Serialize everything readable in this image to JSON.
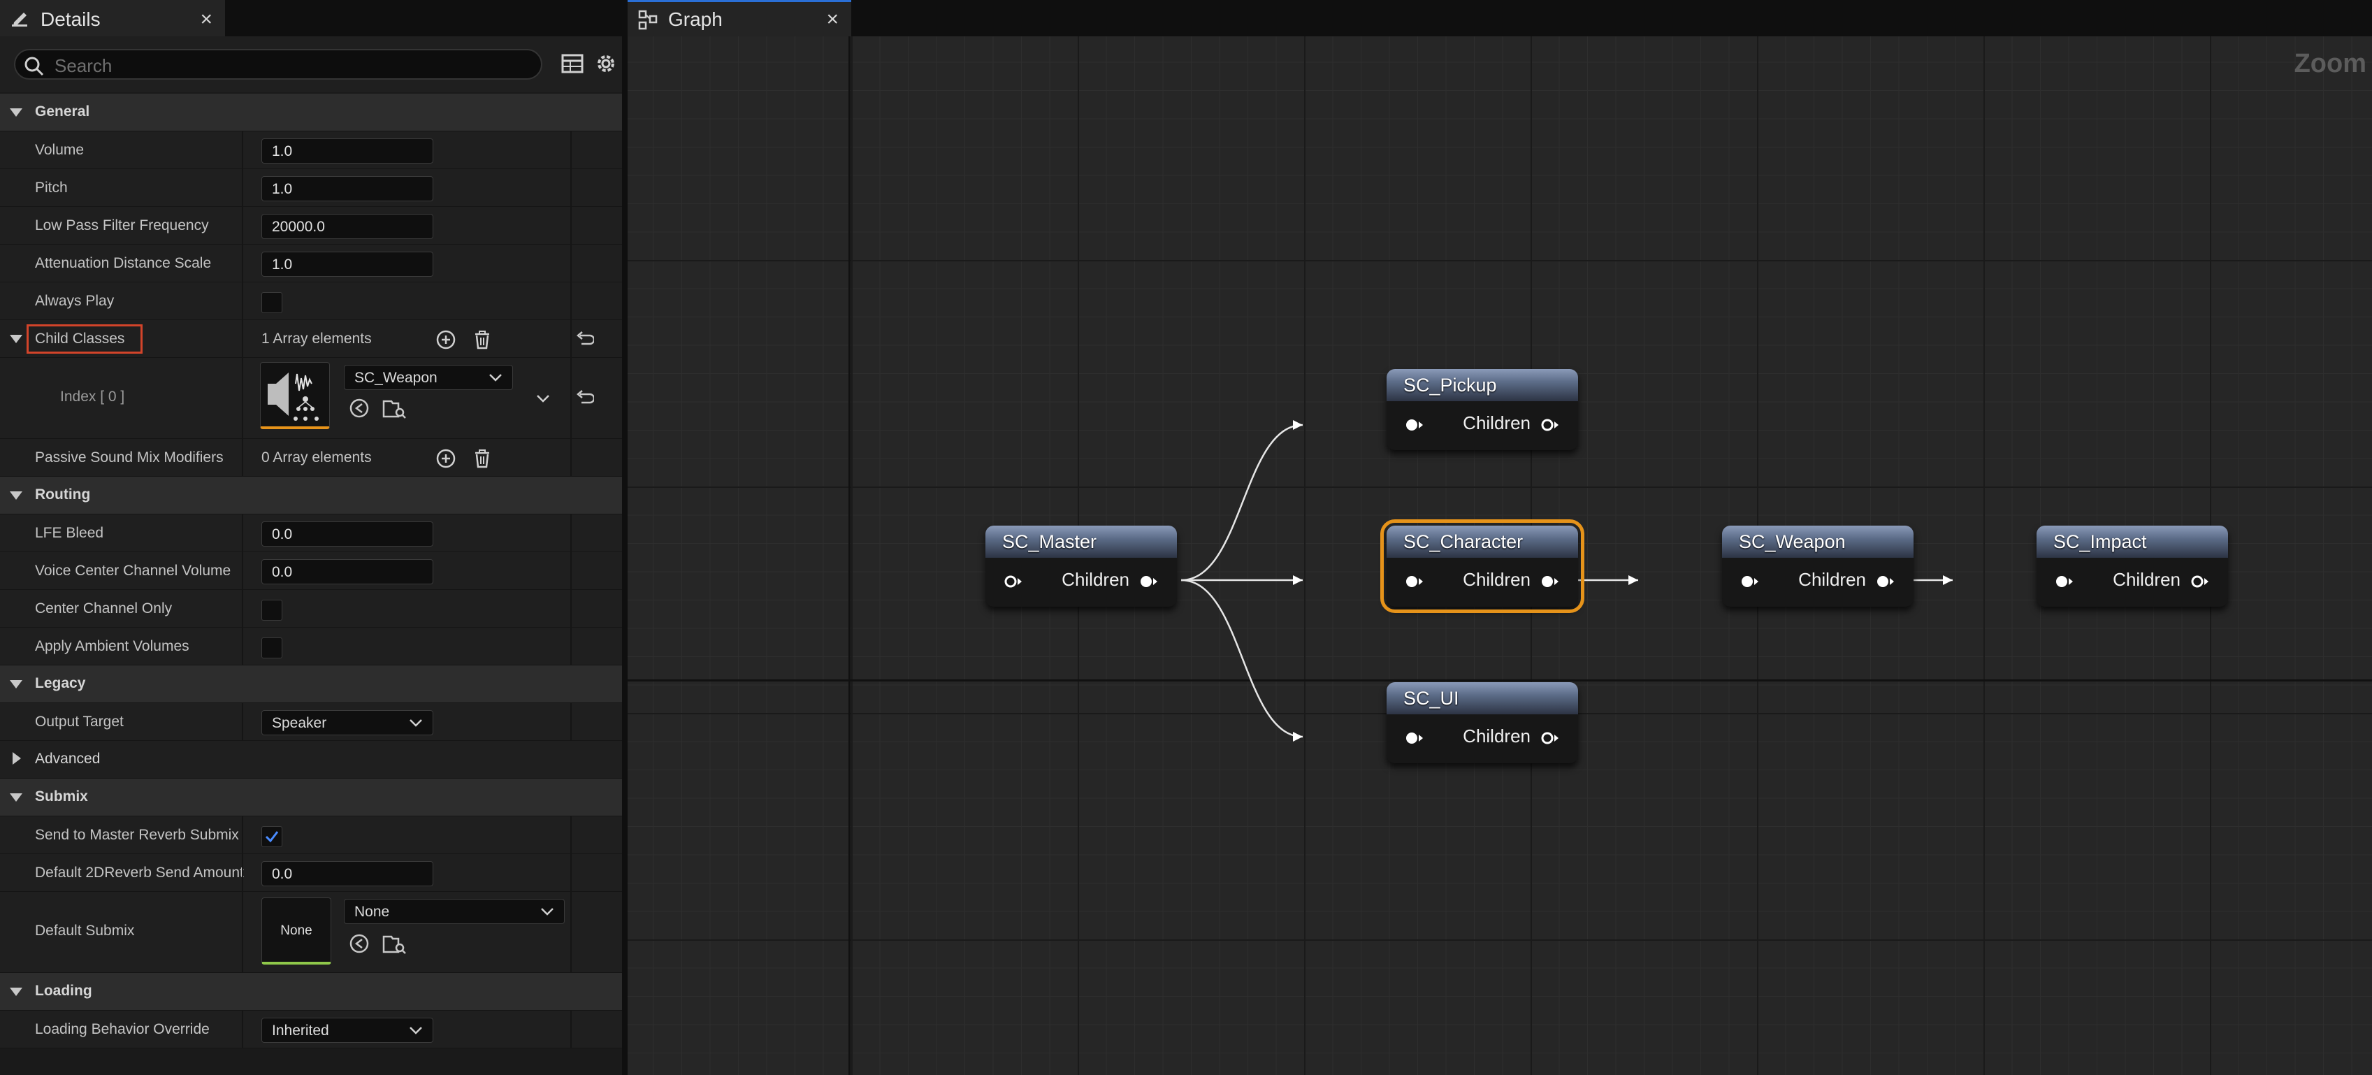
{
  "details": {
    "tab_title": "Details",
    "close_glyph": "×",
    "search_placeholder": "Search",
    "sections": {
      "general": "General",
      "routing": "Routing",
      "legacy": "Legacy",
      "advanced": "Advanced",
      "submix": "Submix",
      "loading": "Loading"
    },
    "fields": {
      "volume": {
        "label": "Volume",
        "value": "1.0"
      },
      "pitch": {
        "label": "Pitch",
        "value": "1.0"
      },
      "low_pass": {
        "label": "Low Pass Filter Frequency",
        "value": "20000.0"
      },
      "attenuation": {
        "label": "Attenuation Distance Scale",
        "value": "1.0"
      },
      "always_play": {
        "label": "Always Play",
        "checked": false
      },
      "child_classes": {
        "label": "Child Classes",
        "value": "1 Array elements"
      },
      "index0": {
        "label": "Index [ 0 ]",
        "value": "SC_Weapon"
      },
      "passive": {
        "label": "Passive Sound Mix Modifiers",
        "value": "0 Array elements"
      },
      "lfe": {
        "label": "LFE Bleed",
        "value": "0.0"
      },
      "voice_center": {
        "label": "Voice Center Channel Volume",
        "value": "0.0"
      },
      "center_only": {
        "label": "Center Channel Only",
        "checked": false
      },
      "ambient": {
        "label": "Apply Ambient Volumes",
        "checked": false
      },
      "output_target": {
        "label": "Output Target",
        "value": "Speaker"
      },
      "send_master": {
        "label": "Send to Master Reverb Submix",
        "checked": true
      },
      "reverb_amount": {
        "label": "Default 2DReverb Send Amount",
        "value": "0.0"
      },
      "default_submix": {
        "label": "Default Submix",
        "value": "None",
        "thumb_text": "None"
      },
      "loading_override": {
        "label": "Loading Behavior Override",
        "value": "Inherited"
      }
    }
  },
  "graph": {
    "tab_title": "Graph",
    "close_glyph": "×",
    "zoom_label": "Zoom",
    "pin_label": "Children",
    "nodes": [
      {
        "id": "master",
        "title": "SC_Master",
        "selected": false
      },
      {
        "id": "pickup",
        "title": "SC_Pickup",
        "selected": false
      },
      {
        "id": "character",
        "title": "SC_Character",
        "selected": true
      },
      {
        "id": "ui",
        "title": "SC_UI",
        "selected": false
      },
      {
        "id": "weapon",
        "title": "SC_Weapon",
        "selected": false
      },
      {
        "id": "impact",
        "title": "SC_Impact",
        "selected": false
      }
    ]
  },
  "colors": {
    "selection": "#e6931a",
    "highlight_box": "#d2442a",
    "checkbox_check": "#4a8cff"
  }
}
